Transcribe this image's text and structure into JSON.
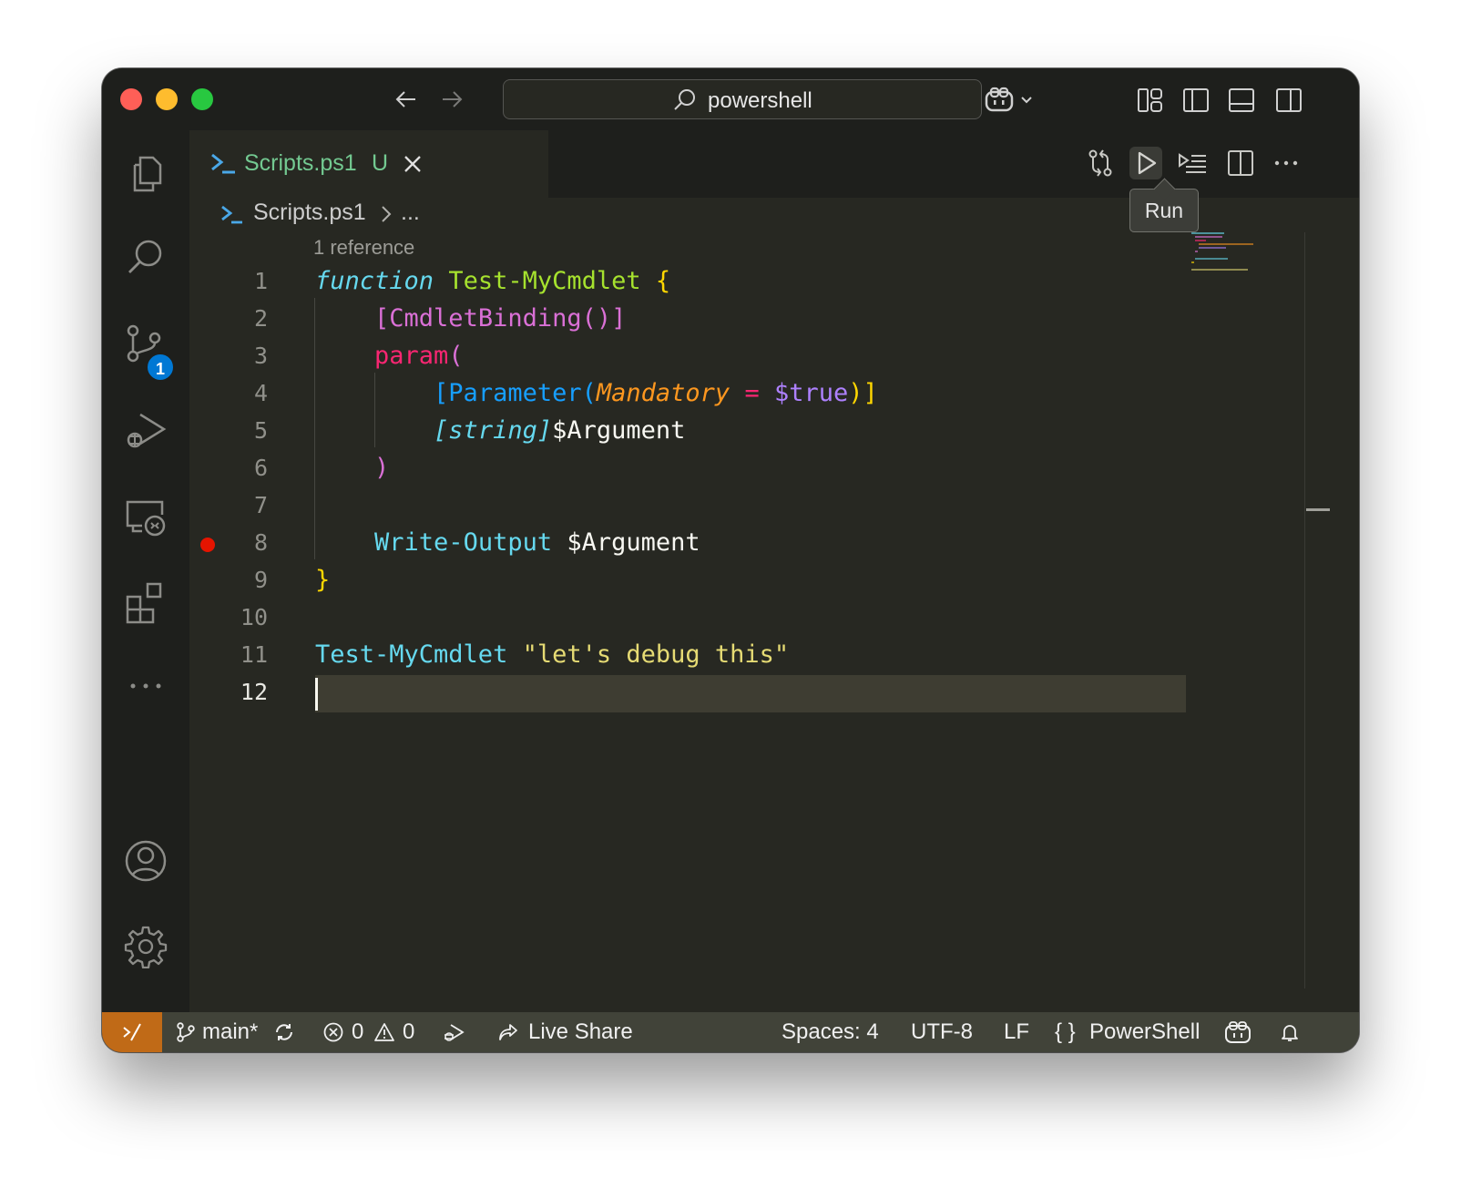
{
  "titlebar": {
    "search_text": "powershell"
  },
  "activity_bar": {
    "source_control_badge": "1"
  },
  "tab": {
    "name": "Scripts.ps1",
    "status": "U"
  },
  "tooltip": {
    "text": "Run"
  },
  "breadcrumb": {
    "file": "Scripts.ps1",
    "more": "..."
  },
  "codelens": "1 reference",
  "line_numbers": [
    "1",
    "2",
    "3",
    "4",
    "5",
    "6",
    "7",
    "8",
    "9",
    "10",
    "11",
    "12"
  ],
  "code": {
    "l1": {
      "kw": "function",
      "name": "Test-MyCmdlet",
      "brace": "{"
    },
    "l2": {
      "attr": "[CmdletBinding()]"
    },
    "l3": {
      "kw": "param",
      "paren": "("
    },
    "l4": {
      "open": "[Parameter(",
      "param": "Mandatory",
      "op": "=",
      "const": "$true",
      "close": ")]"
    },
    "l5": {
      "type": "[string]",
      "var": "$Argument"
    },
    "l6": {
      "paren": ")"
    },
    "l8": {
      "cmd": "Write-Output",
      "var": "$Argument"
    },
    "l9": {
      "brace": "}"
    },
    "l11": {
      "cmd": "Test-MyCmdlet",
      "str": "\"let's debug this\""
    }
  },
  "statusbar": {
    "branch": "main*",
    "errors": "0",
    "warnings": "0",
    "live_share": "Live Share",
    "spaces": "Spaces: 4",
    "encoding": "UTF-8",
    "eol": "LF",
    "language": "PowerShell"
  },
  "colors": {
    "editor_bg": "#272822",
    "chrome_bg": "#1e1f1c",
    "statusbar_bg": "#414339",
    "remote_bg": "#c06a17",
    "badge_bg": "#0078d4",
    "breakpoint": "#e51400"
  }
}
